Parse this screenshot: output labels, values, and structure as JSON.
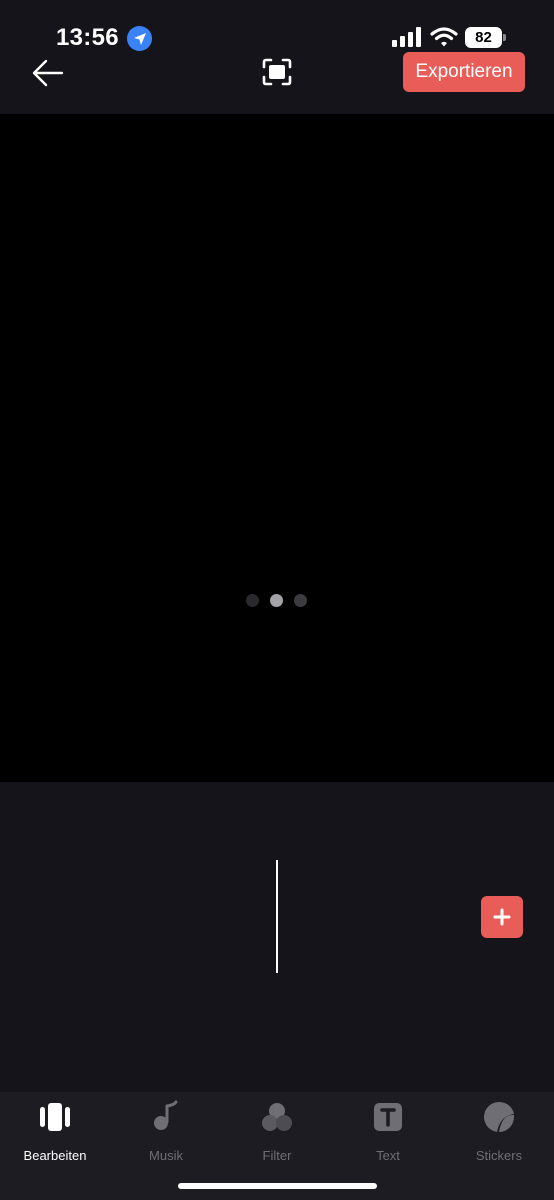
{
  "status_bar": {
    "time": "13:56",
    "battery": "82"
  },
  "header": {
    "export_label": "Exportieren",
    "accent_color": "#e85d58"
  },
  "icons": {
    "back": "arrow-left-icon",
    "fullscreen": "fullscreen-icon",
    "add": "plus-icon"
  },
  "tabs": [
    {
      "label": "Bearbeiten",
      "icon": "edit-clips-icon",
      "active": true
    },
    {
      "label": "Musik",
      "icon": "music-note-icon",
      "active": false
    },
    {
      "label": "Filter",
      "icon": "filter-icon",
      "active": false
    },
    {
      "label": "Text",
      "icon": "text-icon",
      "active": false
    },
    {
      "label": "Stickers",
      "icon": "sticker-icon",
      "active": false
    }
  ]
}
